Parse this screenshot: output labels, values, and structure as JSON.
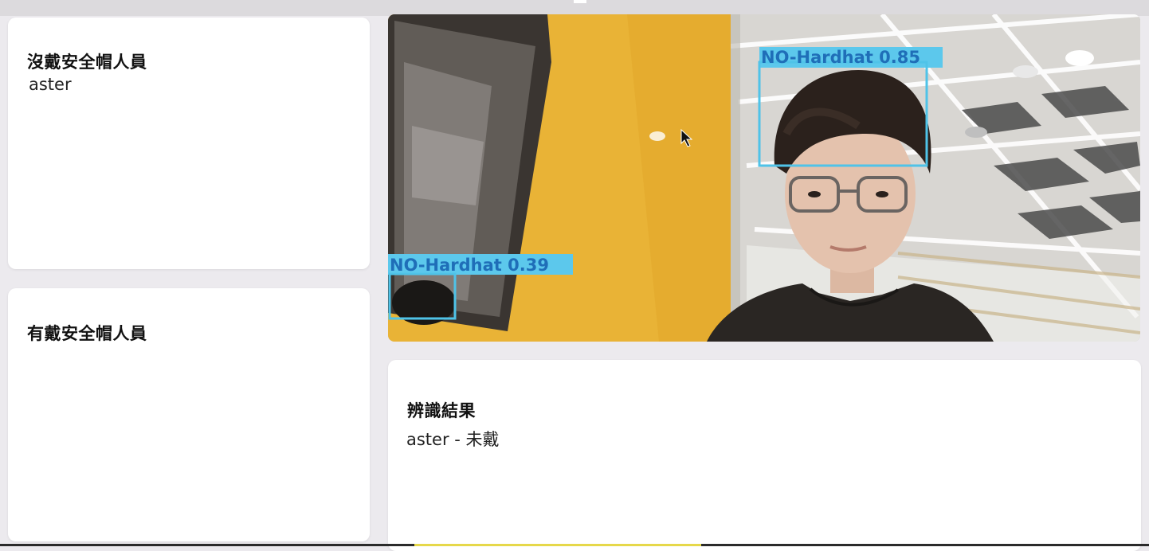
{
  "panels": {
    "no_hardhat": {
      "title": "沒戴安全帽人員",
      "names": [
        "aster"
      ]
    },
    "with_hardhat": {
      "title": "有戴安全帽人員",
      "names": []
    },
    "result": {
      "title": "辨識結果",
      "value": "aster - 未戴"
    }
  },
  "camera": {
    "detections": [
      {
        "label": "NO-Hardhat",
        "confidence": "0.85"
      },
      {
        "label": "NO-Hardhat",
        "confidence": "0.39"
      }
    ]
  },
  "colors": {
    "detection_box": "#4fc3e8",
    "detection_text": "#1f6eb8",
    "wall": "#e9b336"
  }
}
